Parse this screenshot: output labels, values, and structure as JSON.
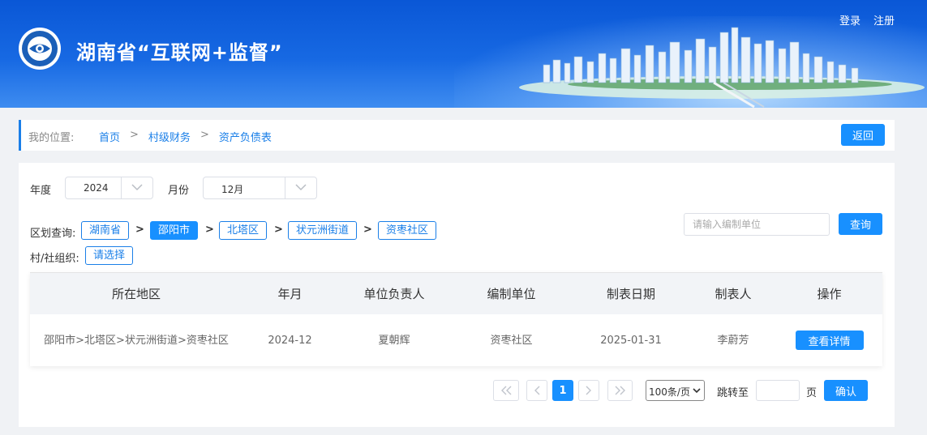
{
  "header": {
    "title": "湖南省“互联网+监督”",
    "login": "登录",
    "register": "注册"
  },
  "breadcrumb": {
    "label": "我的位置:",
    "items": [
      "首页",
      "村级财务",
      "资产负债表"
    ],
    "separator": ">",
    "back": "返回"
  },
  "filters": {
    "year_label": "年度",
    "year_value": "2024",
    "month_label": "月份",
    "month_value": "12月",
    "region_label": "区划查询:",
    "regions": [
      "湖南省",
      "邵阳市",
      "北塔区",
      "状元洲街道",
      "资枣社区"
    ],
    "active_region": "邵阳市",
    "org_label": "村/社组织:",
    "org_value": "请选择",
    "search_placeholder": "请输入编制单位",
    "query": "查询"
  },
  "table": {
    "columns": [
      "所在地区",
      "年月",
      "单位负责人",
      "编制单位",
      "制表日期",
      "制表人",
      "操作"
    ],
    "rows": [
      {
        "region": "邵阳市>北塔区>状元洲街道>资枣社区",
        "period": "2024-12",
        "leader": "夏朝辉",
        "unit": "资枣社区",
        "date": "2025-01-31",
        "maker": "李蔚芳",
        "action": "查看详情"
      }
    ]
  },
  "pagination": {
    "current": "1",
    "page_size": "100条/页",
    "jump_label": "跳转至",
    "page_unit": "页",
    "confirm": "确认"
  },
  "colors": {
    "primary": "#1890ff",
    "header_blue": "#0a57d6"
  }
}
